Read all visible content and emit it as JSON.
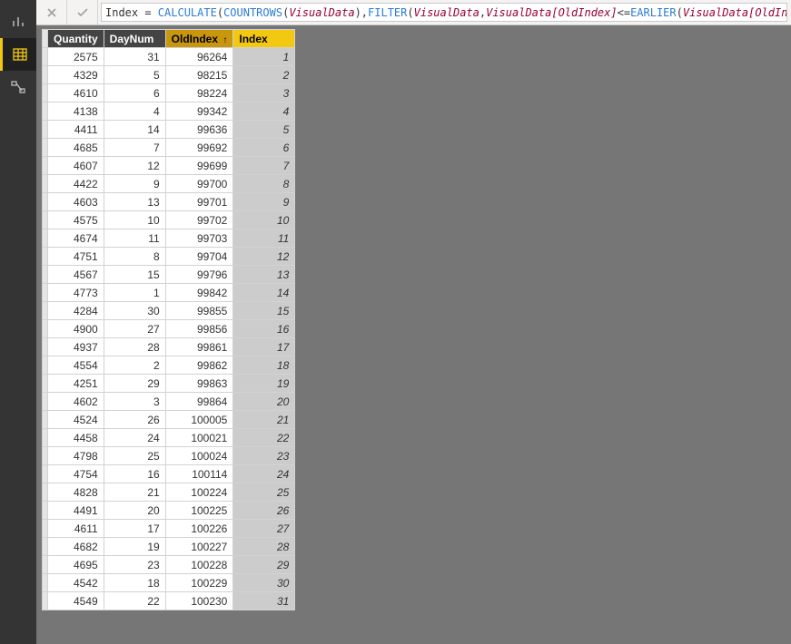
{
  "sidebar": {
    "items": [
      {
        "name": "report-view",
        "icon": "chart"
      },
      {
        "name": "data-view",
        "icon": "table",
        "active": true
      },
      {
        "name": "model-view",
        "icon": "model"
      }
    ]
  },
  "formula": {
    "plain": "Index = CALCULATE(COUNTROWS(VisualData),FILTER(VisualData,VisualData[OldIndex]<=EARLIER(VisualData[OldIndex])))",
    "t0": "Index = ",
    "fn_calc": "CALCULATE",
    "p1": "(",
    "fn_count": "COUNTROWS",
    "p2": "(",
    "ref1": "VisualData",
    "p3": "),",
    "fn_filter": "FILTER",
    "p4": "(",
    "ref2": "VisualData",
    "p5": ",",
    "ref3": "VisualData[OldIndex]",
    "p6": "<=",
    "fn_earlier": "EARLIER",
    "p7": "(",
    "ref4": "VisualData[OldIndex]",
    "p8": ")))"
  },
  "table": {
    "columns": {
      "quantity": "Quantity",
      "daynum": "DayNum",
      "oldindex": "OldIndex",
      "index": "Index",
      "sort_indicator": "↑"
    },
    "rows": [
      {
        "quantity": 2575,
        "daynum": 31,
        "oldindex": 96264,
        "index": 1
      },
      {
        "quantity": 4329,
        "daynum": 5,
        "oldindex": 98215,
        "index": 2
      },
      {
        "quantity": 4610,
        "daynum": 6,
        "oldindex": 98224,
        "index": 3
      },
      {
        "quantity": 4138,
        "daynum": 4,
        "oldindex": 99342,
        "index": 4
      },
      {
        "quantity": 4411,
        "daynum": 14,
        "oldindex": 99636,
        "index": 5
      },
      {
        "quantity": 4685,
        "daynum": 7,
        "oldindex": 99692,
        "index": 6
      },
      {
        "quantity": 4607,
        "daynum": 12,
        "oldindex": 99699,
        "index": 7
      },
      {
        "quantity": 4422,
        "daynum": 9,
        "oldindex": 99700,
        "index": 8
      },
      {
        "quantity": 4603,
        "daynum": 13,
        "oldindex": 99701,
        "index": 9
      },
      {
        "quantity": 4575,
        "daynum": 10,
        "oldindex": 99702,
        "index": 10
      },
      {
        "quantity": 4674,
        "daynum": 11,
        "oldindex": 99703,
        "index": 11
      },
      {
        "quantity": 4751,
        "daynum": 8,
        "oldindex": 99704,
        "index": 12
      },
      {
        "quantity": 4567,
        "daynum": 15,
        "oldindex": 99796,
        "index": 13
      },
      {
        "quantity": 4773,
        "daynum": 1,
        "oldindex": 99842,
        "index": 14
      },
      {
        "quantity": 4284,
        "daynum": 30,
        "oldindex": 99855,
        "index": 15
      },
      {
        "quantity": 4900,
        "daynum": 27,
        "oldindex": 99856,
        "index": 16
      },
      {
        "quantity": 4937,
        "daynum": 28,
        "oldindex": 99861,
        "index": 17
      },
      {
        "quantity": 4554,
        "daynum": 2,
        "oldindex": 99862,
        "index": 18
      },
      {
        "quantity": 4251,
        "daynum": 29,
        "oldindex": 99863,
        "index": 19
      },
      {
        "quantity": 4602,
        "daynum": 3,
        "oldindex": 99864,
        "index": 20
      },
      {
        "quantity": 4524,
        "daynum": 26,
        "oldindex": 100005,
        "index": 21
      },
      {
        "quantity": 4458,
        "daynum": 24,
        "oldindex": 100021,
        "index": 22
      },
      {
        "quantity": 4798,
        "daynum": 25,
        "oldindex": 100024,
        "index": 23
      },
      {
        "quantity": 4754,
        "daynum": 16,
        "oldindex": 100114,
        "index": 24
      },
      {
        "quantity": 4828,
        "daynum": 21,
        "oldindex": 100224,
        "index": 25
      },
      {
        "quantity": 4491,
        "daynum": 20,
        "oldindex": 100225,
        "index": 26
      },
      {
        "quantity": 4611,
        "daynum": 17,
        "oldindex": 100226,
        "index": 27
      },
      {
        "quantity": 4682,
        "daynum": 19,
        "oldindex": 100227,
        "index": 28
      },
      {
        "quantity": 4695,
        "daynum": 23,
        "oldindex": 100228,
        "index": 29
      },
      {
        "quantity": 4542,
        "daynum": 18,
        "oldindex": 100229,
        "index": 30
      },
      {
        "quantity": 4549,
        "daynum": 22,
        "oldindex": 100230,
        "index": 31
      }
    ]
  }
}
